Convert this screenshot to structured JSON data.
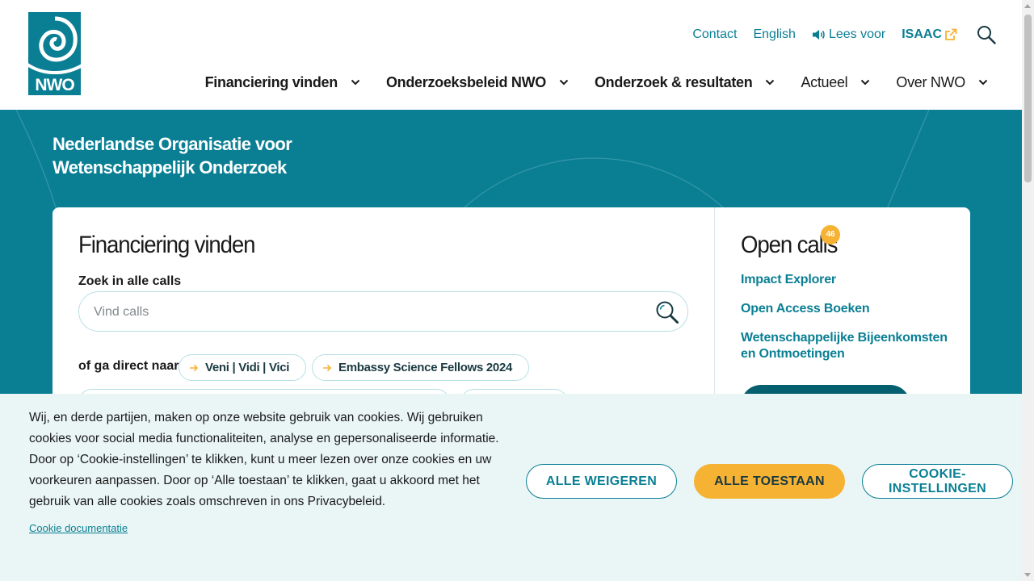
{
  "logo": {
    "text": "NWO",
    "icon": "nwo-logo-icon"
  },
  "util_nav": {
    "contact": "Contact",
    "language": "English",
    "read_aloud": "Lees voor",
    "read_aloud_icon": "speaker-icon",
    "isaac": "ISAAC",
    "isaac_icon": "external-link-icon",
    "search_icon": "search-icon"
  },
  "main_nav": [
    {
      "label": "Financiering vinden"
    },
    {
      "label": "Onderzoeksbeleid NWO"
    },
    {
      "label": "Onderzoek & resultaten"
    },
    {
      "label": "Actueel"
    },
    {
      "label": "Over NWO"
    }
  ],
  "hero": {
    "org_name": "Nederlandse Organisatie voor Wetenschappelijk Onderzoek"
  },
  "funding": {
    "title": "Financiering vinden",
    "search_label": "Zoek in alle calls",
    "search_placeholder": "Vind calls",
    "search_value": "",
    "quick_label": "of ga direct naar",
    "chips": [
      "Veni | Vidi | Vici",
      "Embassy Science Fellows 2024"
    ]
  },
  "open_calls": {
    "title": "Open calls",
    "count": "46",
    "links": [
      "Impact Explorer",
      "Open Access Boeken",
      "Wetenschappelijke Bijeenkomsten en Ontmoetingen"
    ]
  },
  "cookie": {
    "text": "Wij, en derde partijen, maken op onze website gebruik van cookies. Wij gebruiken cookies voor social media functionaliteiten, analyse en gepersonaliseerde informatie. Door op ‘Cookie-instellingen’ te klikken, kunt u meer lezen over onze cookies en uw voorkeuren aanpassen. Door op ‘Alle toestaan’ te klikken, gaat u akkoord met het gebruik van alle cookies zoals omschreven in ons Privacybeleid.",
    "doc_link": "Cookie documentatie",
    "reject_all": "ALLE WEIGEREN",
    "allow_all": "ALLE TOESTAAN",
    "settings": "COOKIE-INSTELLINGEN"
  },
  "colors": {
    "brand_teal": "#0a7f94",
    "accent_orange": "#f6b233",
    "cookie_bg": "#eaf5f5"
  }
}
